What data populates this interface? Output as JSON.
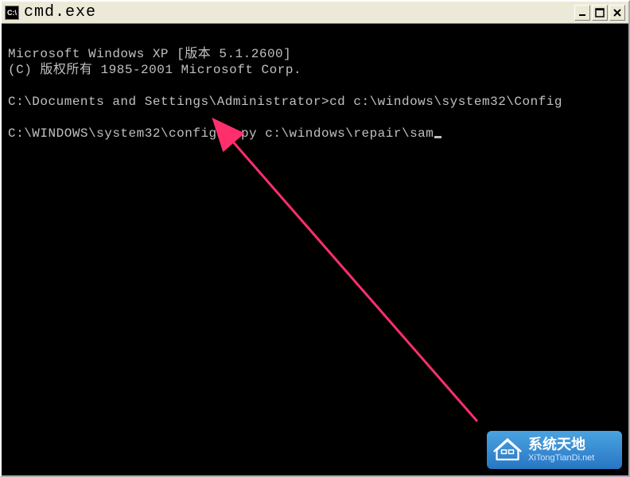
{
  "window": {
    "title": "cmd.exe",
    "icon_label": "C:\\"
  },
  "terminal": {
    "lines": [
      "Microsoft Windows XP [版本 5.1.2600]",
      "(C) 版权所有 1985-2001 Microsoft Corp.",
      "",
      "C:\\Documents and Settings\\Administrator>cd c:\\windows\\system32\\Config",
      "",
      "C:\\WINDOWS\\system32\\config>copy c:\\windows\\repair\\sam"
    ]
  },
  "watermark": {
    "title": "系统天地",
    "url": "XiTongTianDi.net"
  },
  "annotation": {
    "arrow_color": "#ff2f6b"
  }
}
